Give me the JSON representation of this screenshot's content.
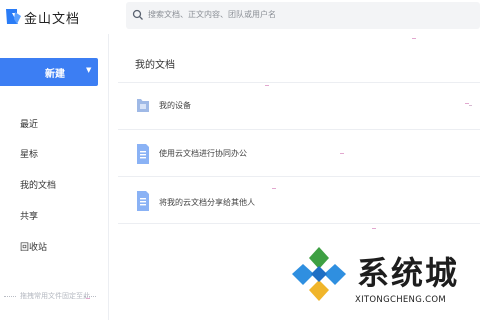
{
  "app": {
    "title": "金山文档"
  },
  "search": {
    "placeholder": "搜索文档、正文内容、团队或用户名"
  },
  "sidebar": {
    "new_button": "新建",
    "items": [
      {
        "label": "最近"
      },
      {
        "label": "星标"
      },
      {
        "label": "我的文档"
      },
      {
        "label": "共享"
      },
      {
        "label": "回收站"
      }
    ],
    "hint": "拖拽常用文件固定至此"
  },
  "main": {
    "title": "我的文档",
    "rows": [
      {
        "name": "我的设备",
        "icon": "folder-icon"
      },
      {
        "name": "使用云文档进行协同办公",
        "icon": "document-icon"
      },
      {
        "name": "将我的云文档分享给其他人",
        "icon": "document-icon"
      }
    ]
  },
  "watermark": {
    "name": "系统城",
    "url": "XITONGCHENG.COM"
  },
  "colors": {
    "accent": "#3c7ef3",
    "doc_icon": "#8ab2f5",
    "folder_icon": "#9fb9e6"
  }
}
